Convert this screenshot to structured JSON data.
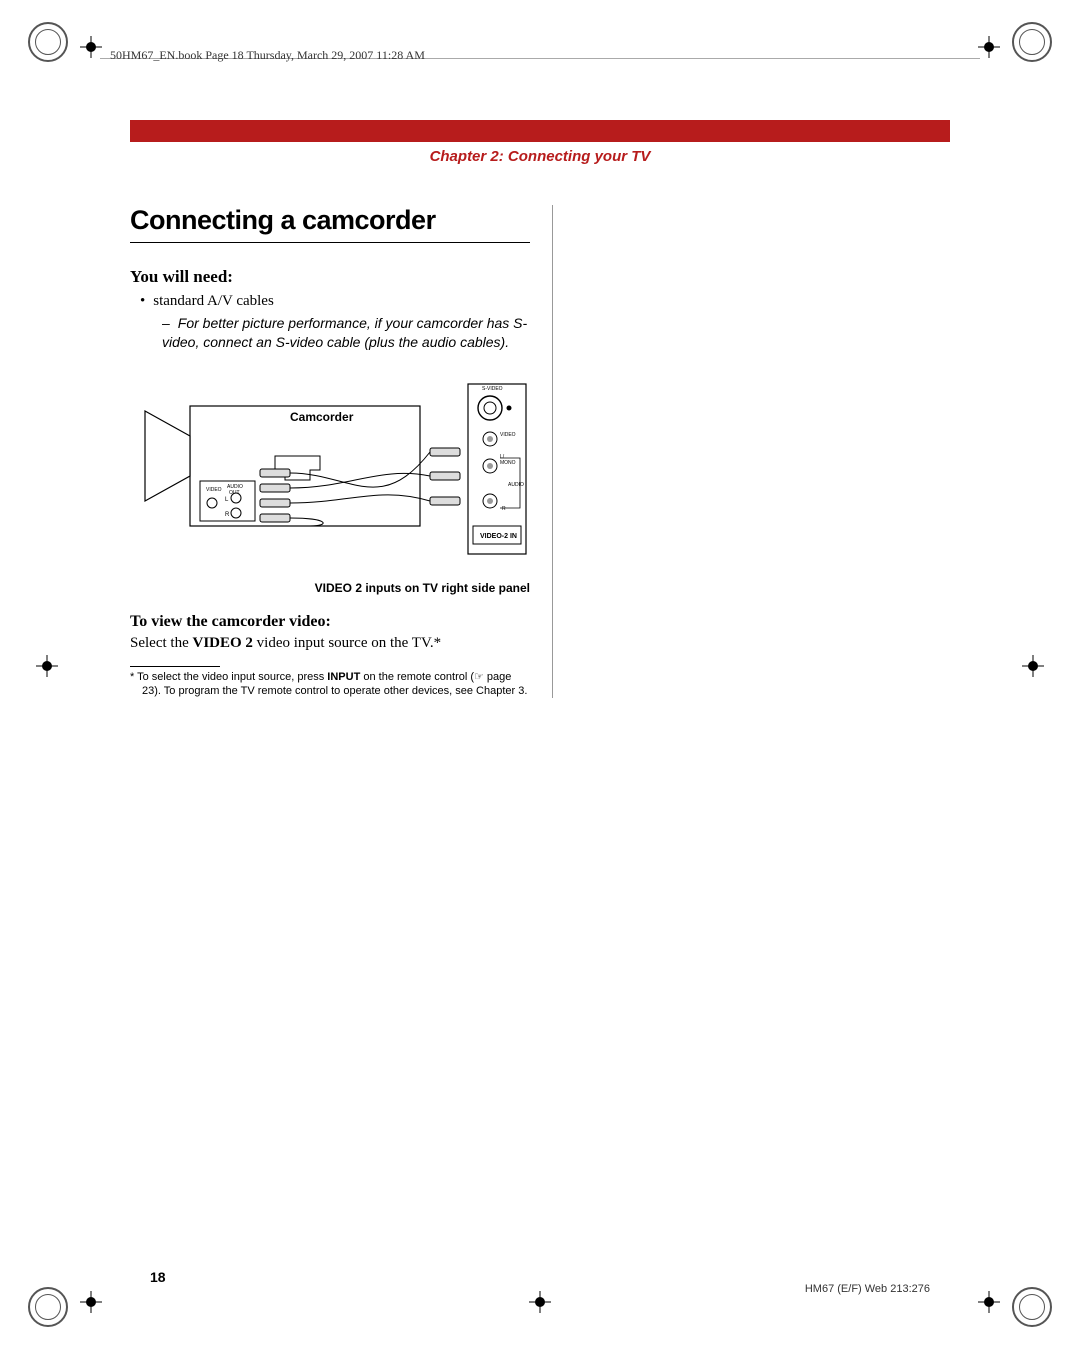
{
  "header_line": "50HM67_EN.book  Page 18  Thursday, March 29, 2007  11:28 AM",
  "chapter_title": "Chapter 2: Connecting your TV",
  "section_title": "Connecting a camcorder",
  "need_heading": "You will need:",
  "bullet1": "standard A/V cables",
  "bullet1_sub": "For better picture performance, if your camcorder has S-video, connect an S-video cable (plus the audio cables).",
  "diagram": {
    "camcorder_label": "Camcorder",
    "video_out": "VIDEO OUT",
    "audio_out": "AUDIO OUT",
    "l": "L",
    "r": "R",
    "svideo": "S-VIDEO",
    "video": "VIDEO",
    "l_mono": "L/ MONO",
    "audio": "AUDIO",
    "r2": "R",
    "panel_label": "VIDEO-2 IN"
  },
  "fig_caption": "VIDEO 2 inputs on TV right side panel",
  "view_heading": "To view the camcorder video:",
  "view_body_pre": "Select the ",
  "view_body_bold": "VIDEO 2",
  "view_body_post": " video input source on the TV.*",
  "footnote_pre": "*  To select the video input source, press ",
  "footnote_bold": "INPUT",
  "footnote_post": " on the remote control (☞ page 23). To program the TV remote control to operate other devices, see Chapter 3.",
  "page_number": "18",
  "web_ref": "HM67 (E/F) Web 213:276"
}
